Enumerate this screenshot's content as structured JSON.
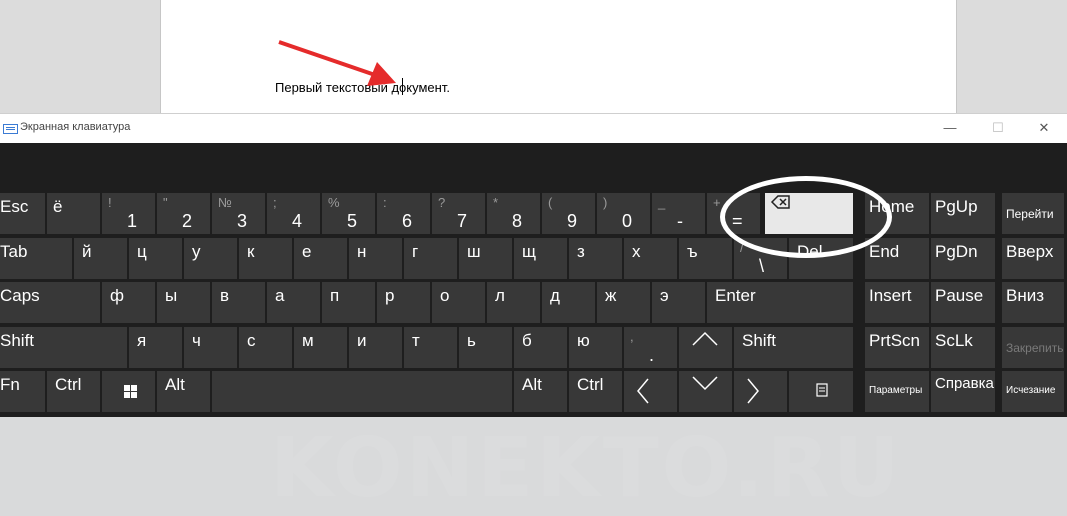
{
  "document": {
    "text": "Первый текстовый документ."
  },
  "osk": {
    "title": "Экранная клавиатура",
    "minimize": "—",
    "maximize": "☐",
    "close": "✕"
  },
  "rows": {
    "r1": [
      {
        "id": "key-esc",
        "main": "Esc"
      },
      {
        "id": "key-yo",
        "main": "ё"
      },
      {
        "id": "key-1",
        "shifted": "!",
        "main": "1"
      },
      {
        "id": "key-2",
        "shifted": "\"",
        "main": "2"
      },
      {
        "id": "key-3",
        "shifted": "№",
        "main": "3"
      },
      {
        "id": "key-4",
        "shifted": ";",
        "main": "4"
      },
      {
        "id": "key-5",
        "shifted": "%",
        "main": "5"
      },
      {
        "id": "key-6",
        "shifted": ":",
        "main": "6"
      },
      {
        "id": "key-7",
        "shifted": "?",
        "main": "7"
      },
      {
        "id": "key-8",
        "shifted": "*",
        "main": "8"
      },
      {
        "id": "key-9",
        "shifted": "(",
        "main": "9"
      },
      {
        "id": "key-0",
        "shifted": ")",
        "main": "0"
      },
      {
        "id": "key-minus",
        "shifted": "_",
        "main": "-"
      },
      {
        "id": "key-equals",
        "shifted": "+",
        "main": "="
      },
      {
        "id": "key-home",
        "main": "Home"
      },
      {
        "id": "key-pgup",
        "main": "PgUp"
      },
      {
        "id": "key-go",
        "main": "Перейти"
      }
    ],
    "r2": [
      {
        "id": "key-tab",
        "main": "Tab"
      },
      {
        "id": "key-y",
        "main": "й"
      },
      {
        "id": "key-ts",
        "main": "ц"
      },
      {
        "id": "key-u",
        "main": "у"
      },
      {
        "id": "key-k",
        "main": "к"
      },
      {
        "id": "key-e",
        "main": "е"
      },
      {
        "id": "key-n",
        "main": "н"
      },
      {
        "id": "key-g",
        "main": "г"
      },
      {
        "id": "key-sh",
        "main": "ш"
      },
      {
        "id": "key-shch",
        "main": "щ"
      },
      {
        "id": "key-z",
        "main": "з"
      },
      {
        "id": "key-h",
        "main": "х"
      },
      {
        "id": "key-hard",
        "main": "ъ"
      },
      {
        "id": "key-backslash",
        "shifted": "/",
        "main": "\\"
      },
      {
        "id": "key-del",
        "main": "Del"
      },
      {
        "id": "key-end",
        "main": "End"
      },
      {
        "id": "key-pgdn",
        "main": "PgDn"
      },
      {
        "id": "key-up-nav",
        "main": "Вверх"
      }
    ],
    "r3": [
      {
        "id": "key-caps",
        "main": "Caps"
      },
      {
        "id": "key-f",
        "main": "ф"
      },
      {
        "id": "key-yy",
        "main": "ы"
      },
      {
        "id": "key-v",
        "main": "в"
      },
      {
        "id": "key-a",
        "main": "а"
      },
      {
        "id": "key-p",
        "main": "п"
      },
      {
        "id": "key-r",
        "main": "р"
      },
      {
        "id": "key-o",
        "main": "о"
      },
      {
        "id": "key-l",
        "main": "л"
      },
      {
        "id": "key-d",
        "main": "д"
      },
      {
        "id": "key-zh",
        "main": "ж"
      },
      {
        "id": "key-ee",
        "main": "э"
      },
      {
        "id": "key-enter",
        "main": "Enter"
      },
      {
        "id": "key-insert",
        "main": "Insert"
      },
      {
        "id": "key-pause",
        "main": "Pause"
      },
      {
        "id": "key-down-nav",
        "main": "Вниз"
      }
    ],
    "r4": [
      {
        "id": "key-shift-left",
        "main": "Shift"
      },
      {
        "id": "key-ya",
        "main": "я"
      },
      {
        "id": "key-ch",
        "main": "ч"
      },
      {
        "id": "key-s",
        "main": "с"
      },
      {
        "id": "key-m",
        "main": "м"
      },
      {
        "id": "key-i",
        "main": "и"
      },
      {
        "id": "key-t",
        "main": "т"
      },
      {
        "id": "key-soft",
        "main": "ь"
      },
      {
        "id": "key-b",
        "main": "б"
      },
      {
        "id": "key-yu",
        "main": "ю"
      },
      {
        "id": "key-period",
        "shifted": ",",
        "main": "."
      },
      {
        "id": "key-shift-right",
        "main": "Shift"
      },
      {
        "id": "key-prtscn",
        "main": "PrtScn"
      },
      {
        "id": "key-sclk",
        "main": "ScLk"
      },
      {
        "id": "key-dock",
        "main": "Закрепить"
      }
    ],
    "r5": [
      {
        "id": "key-fn",
        "main": "Fn"
      },
      {
        "id": "key-ctrl-left",
        "main": "Ctrl"
      },
      {
        "id": "key-alt-left",
        "main": "Alt"
      },
      {
        "id": "key-alt-right",
        "main": "Alt"
      },
      {
        "id": "key-ctrl-right",
        "main": "Ctrl"
      },
      {
        "id": "key-options",
        "main": "Параметры"
      },
      {
        "id": "key-help",
        "main": "Справка"
      },
      {
        "id": "key-fade",
        "main": "Исчезание"
      }
    ]
  },
  "watermark": "KONEKTO.RU"
}
